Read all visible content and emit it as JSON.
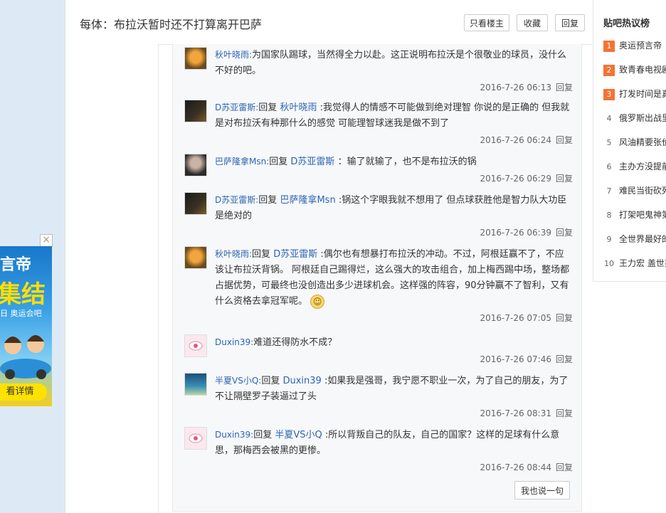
{
  "header": {
    "title": "每体：布拉沃暂时还不打算离开巴萨",
    "btn_only_op": "只看楼主",
    "btn_favorite": "收藏",
    "btn_reply": "回复"
  },
  "replies": [
    {
      "user": "秋叶晓雨:",
      "reply_word": "",
      "target": "",
      "text": "为国家队踢球，当然得全力以赴。这正说明布拉沃是个很敬业的球员，没什么不好的吧。",
      "time": "2016-7-26 06:13",
      "action": "回复",
      "avatar": "avatar-lion"
    },
    {
      "user": "D苏亚雷斯:",
      "reply_word": "回复",
      "target": "秋叶晓雨",
      "text": ":我觉得人的情感不可能做到绝对理智 你说的是正确的 但我就是对布拉沃有种那什么的感觉 可能理智球迷我是做不到了",
      "time": "2016-7-26 06:24",
      "action": "回复",
      "avatar": "avatar-dark"
    },
    {
      "user": "巴萨隆拿Msn:",
      "reply_word": "回复",
      "target": "D苏亚雷斯",
      "text": "：输了就输了，也不是布拉沃的锅",
      "time": "2016-7-26 06:29",
      "action": "回复",
      "avatar": "avatar-girl"
    },
    {
      "user": "D苏亚雷斯:",
      "reply_word": "回复",
      "target": "巴萨隆拿Msn",
      "text": ":锅这个字眼我就不想用了 但点球获胜他是智力队大功臣是绝对的",
      "time": "2016-7-26 06:39",
      "action": "回复",
      "avatar": "avatar-dark"
    },
    {
      "user": "秋叶晓雨:",
      "reply_word": "回复",
      "target": "D苏亚雷斯",
      "text": ":偶尔也有想暴打布拉沃的冲动。不过，阿根廷赢不了，不应该让布拉沃背锅。 阿根廷自己踢得烂，这么强大的攻击组合，加上梅西踢中场，整场都占据优势，可最终也没创造出多少进球机会。这样强的阵容，90分钟赢不了智利，又有什么资格去拿冠军呢。",
      "time": "2016-7-26 07:05",
      "action": "回复",
      "avatar": "avatar-lion"
    },
    {
      "user": "Duxin39:",
      "reply_word": "",
      "target": "",
      "text": "难道还得防水不成？",
      "time": "2016-7-26 07:46",
      "action": "回复",
      "avatar": "avatar-pink"
    },
    {
      "user": "半夏VS小Q:",
      "reply_word": "回复",
      "target": "Duxin39",
      "text": ":如果我是强哥，我宁愿不职业一次，为了自己的朋友，为了不让隔壁罗子装逼过了头",
      "time": "2016-7-26 08:31",
      "action": "回复",
      "avatar": "avatar-sea"
    },
    {
      "user": "Duxin39:",
      "reply_word": "回复",
      "target": "半夏VS小Q",
      "text": ":所以背叛自己的队友，自己的国家？这样的足球有什么意思，那梅西会被黑的更惨。",
      "time": "2016-7-26 08:44",
      "action": "回复",
      "avatar": "avatar-pink"
    }
  ],
  "say_button": "我也说一句",
  "hot_list": {
    "title": "贴吧热议榜",
    "items": [
      {
        "rank": "1",
        "text": "奥运预言帝"
      },
      {
        "rank": "2",
        "text": "致青春电视剧"
      },
      {
        "rank": "3",
        "text": "打发时间是真"
      },
      {
        "rank": "4",
        "text": "俄罗斯出战里"
      },
      {
        "rank": "5",
        "text": "风油精要张价"
      },
      {
        "rank": "6",
        "text": "主办方没提前"
      },
      {
        "rank": "7",
        "text": "难民当街砍死"
      },
      {
        "rank": "8",
        "text": "打架吧鬼神第"
      },
      {
        "rank": "9",
        "text": "全世界最好的"
      },
      {
        "rank": "10",
        "text": "王力宏 盖世英"
      }
    ]
  },
  "ad": {
    "line1": "言帝",
    "line2": "集结",
    "line3": "日 奥运会吧",
    "button": "看详情",
    "close": "×"
  },
  "colors": {
    "accent": "#2d64b3",
    "rank_top": "#f57333",
    "ad_yellow": "#ffe100"
  }
}
